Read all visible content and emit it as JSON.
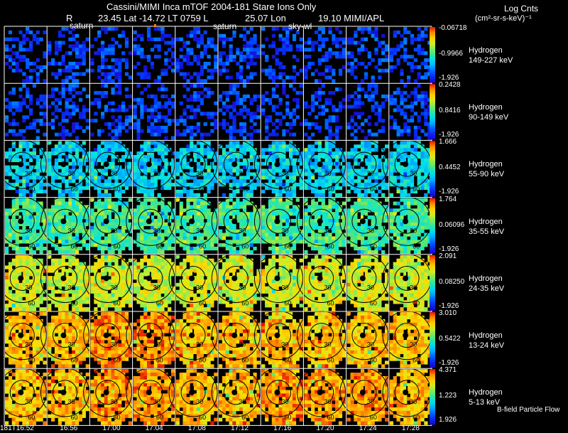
{
  "header": {
    "line1": "Cassini/MIMI Inca mTOF  2004-181   Stare    Ions Only",
    "r_label": "R",
    "position": "23.45 Lat -14.72 LT 0759 L",
    "lon": "25.07 Lon",
    "mimi": "19.10  MIMI/APL",
    "targets": [
      "saturn",
      "saturn",
      "sky-wl"
    ]
  },
  "units": {
    "line1": "Log Cnts",
    "line2": "(cm²-sr-s-keV)⁻¹"
  },
  "rows": [
    {
      "species": "Hydrogen",
      "energy": "149-227 keV",
      "cb_top": "-0.06718",
      "cb_mid": "-0.9966",
      "cb_bot": "-1.926",
      "palette": "blue"
    },
    {
      "species": "Hydrogen",
      "energy": "90-149 keV",
      "cb_top": "0.2428",
      "cb_mid": "0.8416",
      "cb_bot": "-1.926",
      "palette": "blue"
    },
    {
      "species": "Hydrogen",
      "energy": "55-90 keV",
      "cb_top": "1.666",
      "cb_mid": "0.4452",
      "cb_bot": "-1.926",
      "palette": "cyan"
    },
    {
      "species": "Hydrogen",
      "energy": "35-55 keV",
      "cb_top": "1.764",
      "cb_mid": "0.06096",
      "cb_bot": "-1.926",
      "palette": "green"
    },
    {
      "species": "Hydrogen",
      "energy": "24-35 keV",
      "cb_top": "2.091",
      "cb_mid": "0.08250",
      "cb_bot": "-1.926",
      "palette": "yellow"
    },
    {
      "species": "Hydrogen",
      "energy": "13-24 keV",
      "cb_top": "3.010",
      "cb_mid": "0.5422",
      "cb_bot": "-1.926",
      "palette": "orange"
    },
    {
      "species": "Hydrogen",
      "energy": "5-13 keV",
      "cb_top": "4.371",
      "cb_mid": "1.223",
      "cb_bot": "1.926",
      "palette": "orange"
    }
  ],
  "ring_labels": [
    "30",
    "60"
  ],
  "times": [
    "181T16:52",
    "16:56",
    "17:00",
    "17:04",
    "17:08",
    "17:12",
    "17:16",
    "17:20",
    "17:24",
    "17:28"
  ],
  "footer": "B-field Particle Flow",
  "colors": {
    "background": "#000000",
    "grid": "#ffffff",
    "ring": "#000000"
  }
}
